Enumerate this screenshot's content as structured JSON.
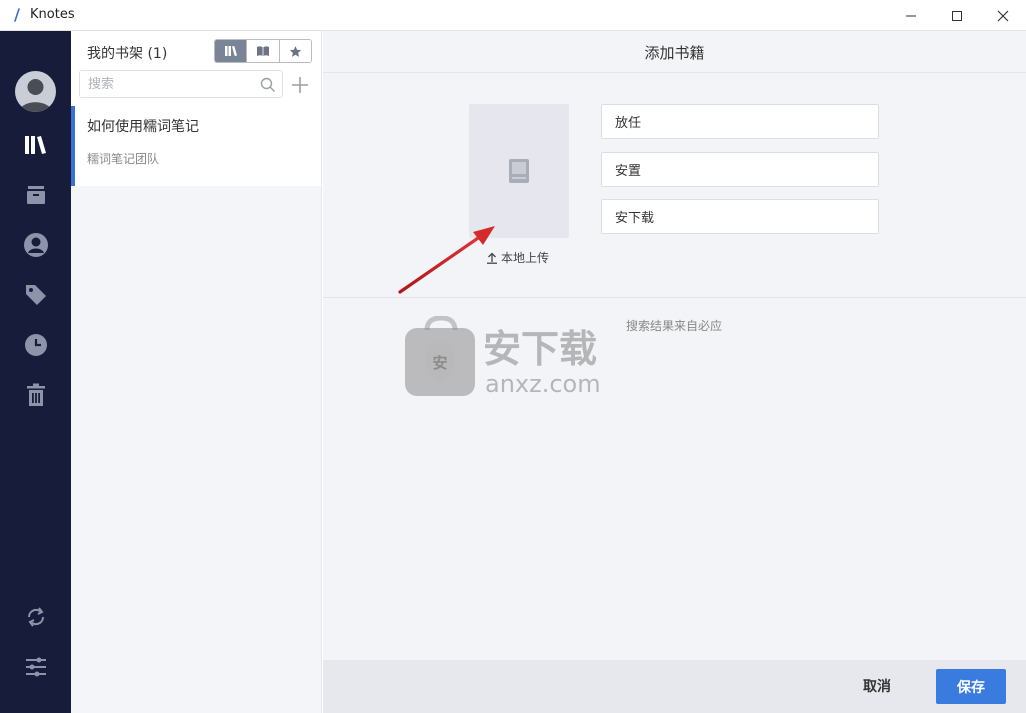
{
  "window": {
    "title": "Knotes"
  },
  "nav": {
    "items": [
      "books-icon",
      "archive-icon",
      "user-icon",
      "tags-icon",
      "clock-icon",
      "trash-icon",
      "sync-icon",
      "settings-icon"
    ]
  },
  "shelf": {
    "title": "我的书架 (1)",
    "search_placeholder": "搜索",
    "books": [
      {
        "title": "如何使用糯词笔记",
        "author": "糯词笔记团队"
      }
    ]
  },
  "main": {
    "title": "添加书籍",
    "fields": [
      {
        "value": "放任"
      },
      {
        "value": "安置"
      },
      {
        "value": "安下载"
      }
    ],
    "upload_label": "本地上传",
    "source_note": "搜索结果来自必应",
    "watermark_text": "安下载",
    "watermark_url": "anxz.com",
    "watermark_badge": "安"
  },
  "footer": {
    "cancel_label": "取消",
    "save_label": "保存"
  },
  "colors": {
    "nav_bg": "#161c3a",
    "accent": "#3b6fd1",
    "save_button": "#3a7be0"
  }
}
